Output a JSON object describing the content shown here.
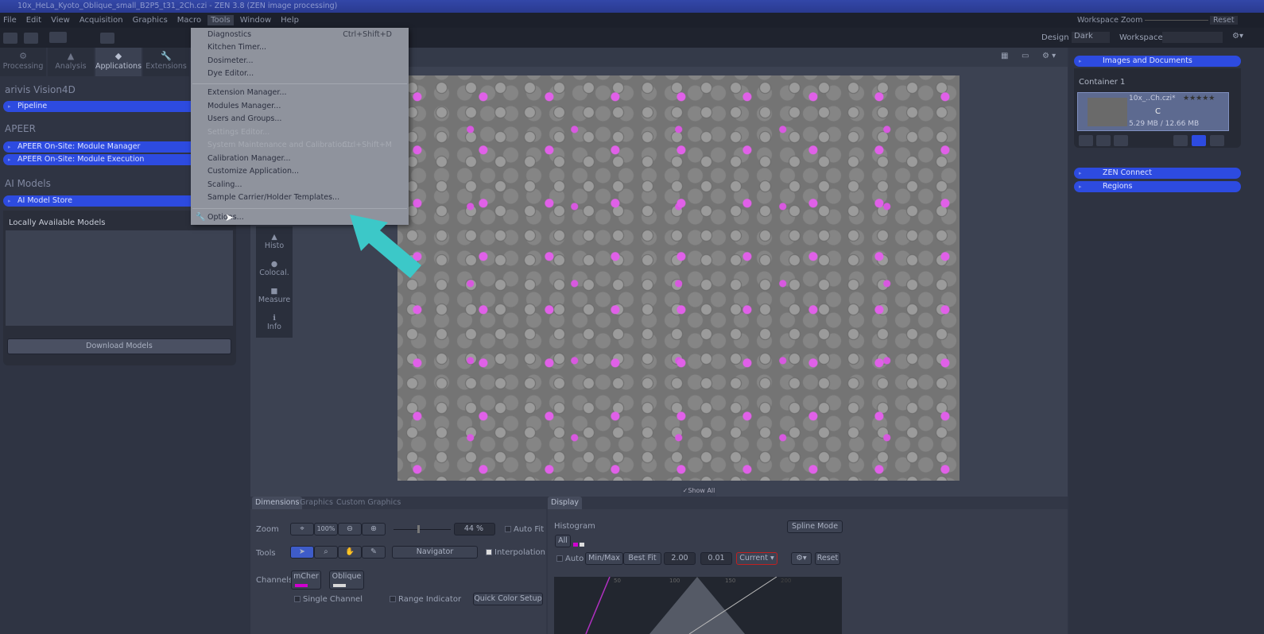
{
  "window": {
    "title": "10x_HeLa_Kyoto_Oblique_small_B2P5_t31_2Ch.czi - ZEN 3.8 (ZEN image processing)"
  },
  "menubar": [
    "File",
    "Edit",
    "View",
    "Acquisition",
    "Graphics",
    "Macro",
    "Tools",
    "Window",
    "Help"
  ],
  "topright": {
    "workspace_zoom": "Workspace Zoom",
    "reset": "Reset",
    "design_label": "Design",
    "design_value": "Dark",
    "workspace_label": "Workspace"
  },
  "left_tabs": [
    "Processing",
    "Analysis",
    "Applications",
    "Extensions"
  ],
  "left_panel": {
    "sections": [
      {
        "title": "arivis Vision4D",
        "items": [
          "Pipeline"
        ]
      },
      {
        "title": "APEER",
        "items": [
          "APEER On-Site: Module Manager",
          "APEER On-Site: Module Execution"
        ]
      },
      {
        "title": "AI Models",
        "items": [
          "AI Model Store"
        ]
      }
    ],
    "locally_available": "Locally Available Models",
    "download": "Download Models"
  },
  "tools_menu": {
    "group1": [
      {
        "label": "Diagnostics",
        "shortcut": "Ctrl+Shift+D"
      },
      {
        "label": "Kitchen Timer..."
      },
      {
        "label": "Dosimeter..."
      },
      {
        "label": "Dye Editor..."
      }
    ],
    "group2": [
      {
        "label": "Extension Manager..."
      },
      {
        "label": "Modules Manager..."
      },
      {
        "label": "Users and Groups..."
      },
      {
        "label": "Settings Editor...",
        "disabled": true
      },
      {
        "label": "System Maintenance and Calibration...",
        "shortcut": "Ctrl+Shift+M",
        "disabled": true
      },
      {
        "label": "Calibration Manager..."
      },
      {
        "label": "Customize Application..."
      },
      {
        "label": "Scaling..."
      },
      {
        "label": "Sample Carrier/Holder Templates..."
      }
    ],
    "group3": [
      {
        "label": "Options..."
      }
    ]
  },
  "side_tools": [
    "Histo",
    "Colocal.",
    "Measure",
    "Info"
  ],
  "show_all": "Show All",
  "right_panel": {
    "images_docs": "Images and Documents",
    "container": "Container 1",
    "file": "10x_..Ch.czi*",
    "channel": "C",
    "size": "5.29 MB / 12.66 MB",
    "rating": "★★★★★",
    "zen_connect": "ZEN Connect",
    "regions": "Regions"
  },
  "dimensions": {
    "tabs": [
      "Dimensions",
      "Graphics",
      "Custom Graphics"
    ],
    "zoom_label": "Zoom",
    "zoom_100": "100%",
    "zoom_value": "44 %",
    "auto_fit": "Auto Fit",
    "tools_label": "Tools",
    "navigator": "Navigator",
    "interpolation": "Interpolation",
    "channels_label": "Channels",
    "channels": [
      {
        "name": "mCher",
        "color": "#d000d0"
      },
      {
        "name": "Oblique",
        "color": "#d8d8d8"
      }
    ],
    "single_channel": "Single Channel",
    "range_indicator": "Range Indicator",
    "quick_color": "Quick Color Setup"
  },
  "display": {
    "tab": "Display",
    "histogram": "Histogram",
    "all": "All",
    "spline": "Spline Mode",
    "auto": "Auto",
    "minmax": "Min/Max",
    "bestfit": "Best Fit",
    "gamma": "2.00",
    "value2": "0.01",
    "current": "Current",
    "reset": "Reset",
    "ticks": [
      "50",
      "100",
      "150",
      "200"
    ]
  },
  "colors": {
    "accent": "#2d4be0",
    "arrow": "#3cc8c8",
    "highlight": "#c02020"
  }
}
